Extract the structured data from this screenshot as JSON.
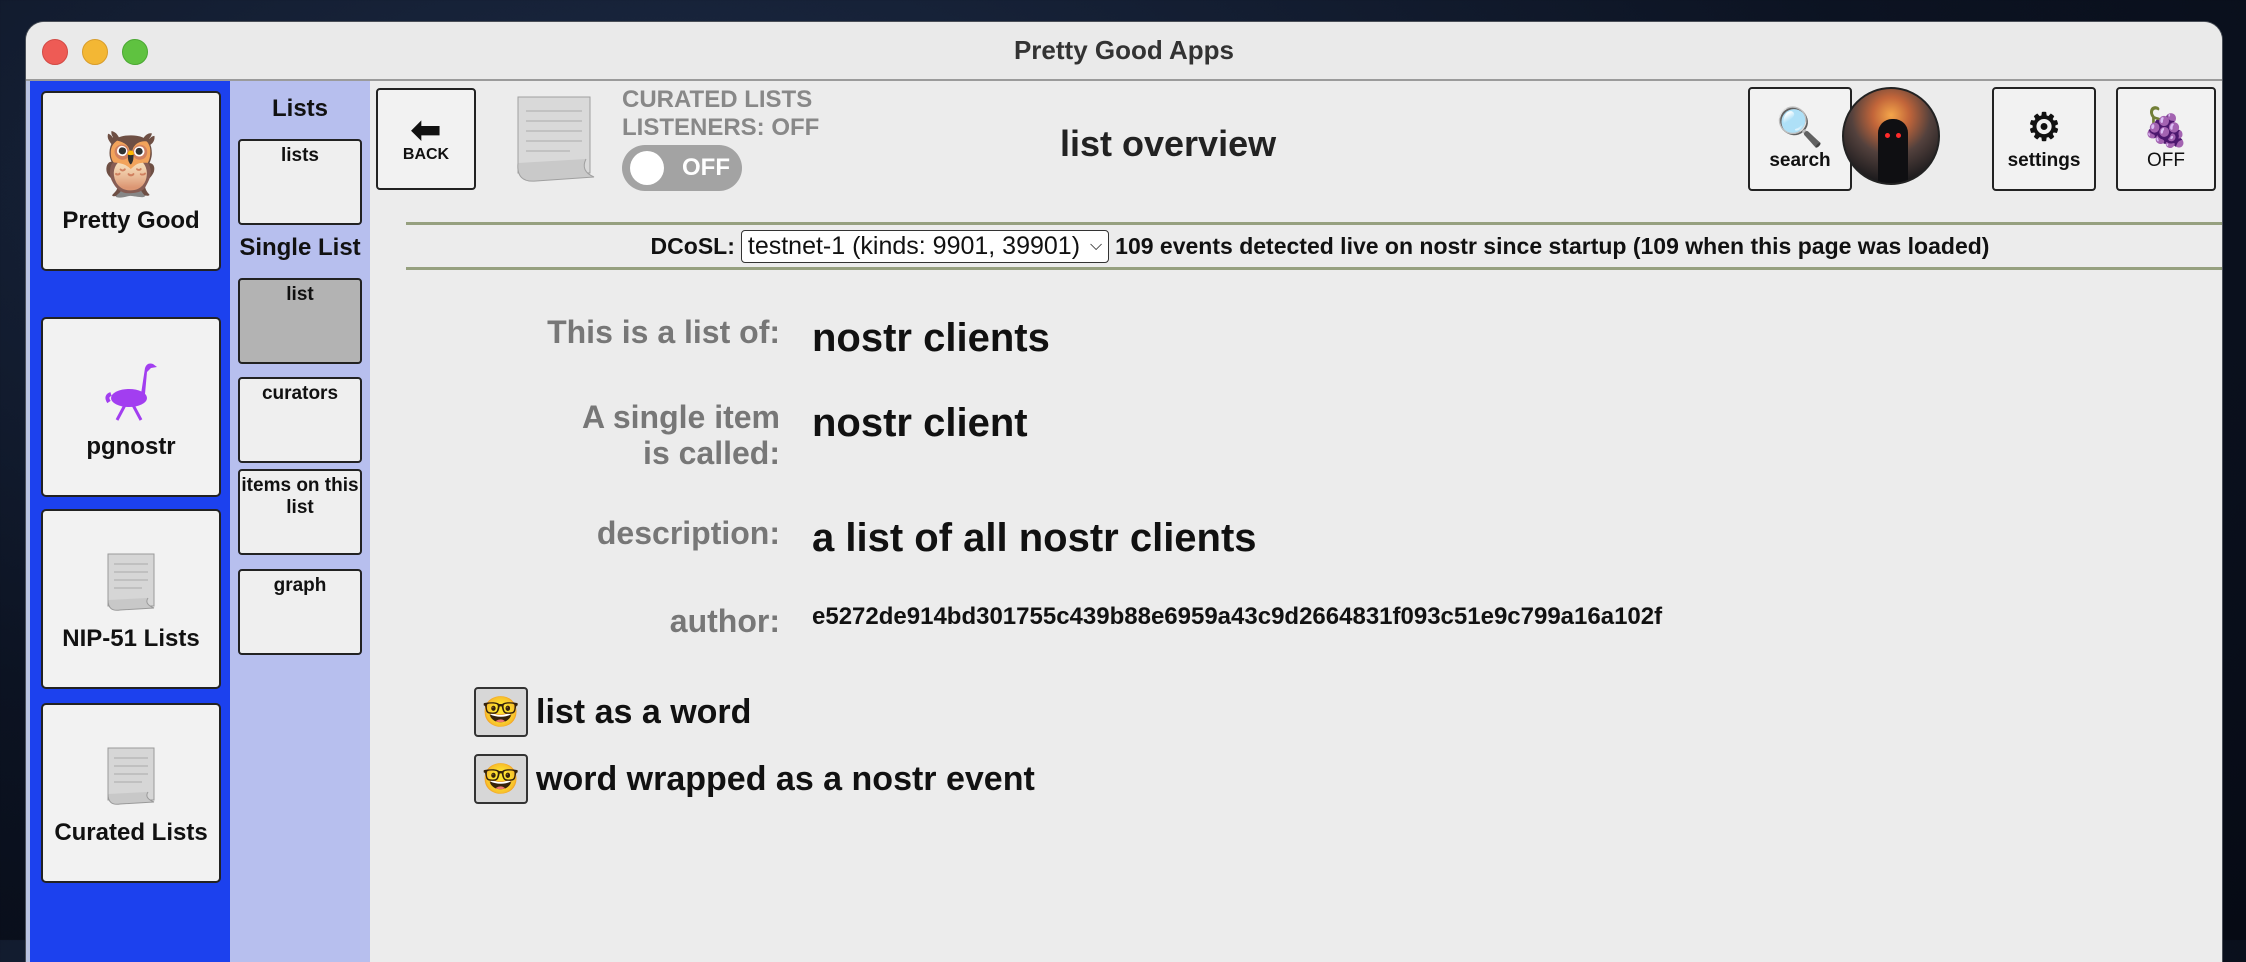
{
  "window": {
    "title": "Pretty Good Apps"
  },
  "apps": [
    {
      "label": "Pretty Good",
      "icon": "owl-icon",
      "glyph": "🦉"
    },
    {
      "label": "pgnostr",
      "icon": "ostrich-icon",
      "glyph": "🐦"
    },
    {
      "label": "NIP-51 Lists",
      "icon": "scroll-icon",
      "glyph": "📜"
    },
    {
      "label": "Curated Lists",
      "icon": "scroll-icon",
      "glyph": "📜"
    }
  ],
  "nav": {
    "lists_heading": "Lists",
    "lists_items": [
      "lists"
    ],
    "single_heading": "Single List",
    "single_items": [
      "list",
      "curators",
      "items on this list",
      "graph"
    ]
  },
  "header": {
    "back_label": "BACK",
    "listeners_line1": "CURATED LISTS",
    "listeners_line2": "LISTENERS: OFF",
    "toggle_label": "OFF",
    "page_title": "list overview",
    "search_label": "search",
    "settings_label": "settings",
    "grapevine_label": "OFF"
  },
  "dcosl": {
    "label": "DCoSL:",
    "selected": "testnet-1 (kinds: 9901, 39901)",
    "status": "109 events detected live on nostr since startup (109 when this page was loaded)"
  },
  "details": {
    "list_of_label": "This is a list of:",
    "list_of_value": "nostr clients",
    "single_item_label": "A single item is called:",
    "single_item_value": "nostr client",
    "description_label": "description:",
    "description_value": "a list of all nostr clients",
    "author_label": "author:",
    "author_value": "e5272de914bd301755c439b88e6959a43c9d2664831f093c51e9c799a16a102f"
  },
  "links": [
    {
      "label": "list as a word",
      "glyph": "🤓"
    },
    {
      "label": "word wrapped as a nostr event",
      "glyph": "🤓"
    }
  ],
  "colors": {
    "apps_column": "#1c41ee",
    "nav_column": "#b7bfee",
    "divider": "#96a07f"
  }
}
